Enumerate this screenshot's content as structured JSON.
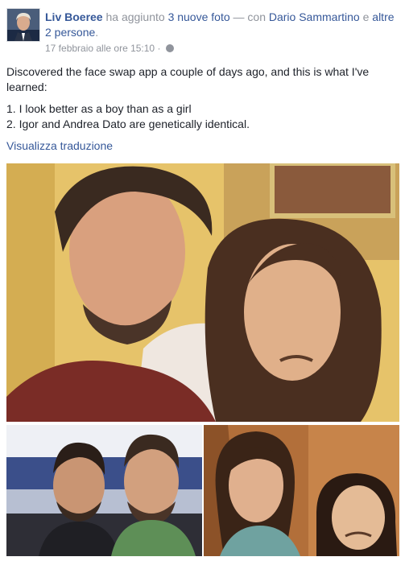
{
  "author": {
    "name": "Liv Boeree"
  },
  "header": {
    "action_text": " ha aggiunto ",
    "photos_link": "3 nuove foto",
    "with_text": " — con ",
    "tagged_person": "Dario Sammartino",
    "and_text": " e ",
    "others_link": "altre 2 persone",
    "end_text": "."
  },
  "meta": {
    "timestamp": "17 febbraio alle ore 15:10",
    "separator": " · ",
    "privacy_icon": "globe-icon"
  },
  "post": {
    "lines": [
      "Discovered the face swap app a couple of days ago, and this is what I've learned:",
      "1. I look better as a boy than as a girl",
      "2. Igor and Andrea Dato are genetically identical."
    ]
  },
  "translate_link": "Visualizza traduzione",
  "colors": {
    "link": "#365899",
    "muted": "#90949c",
    "text": "#1d2129"
  }
}
